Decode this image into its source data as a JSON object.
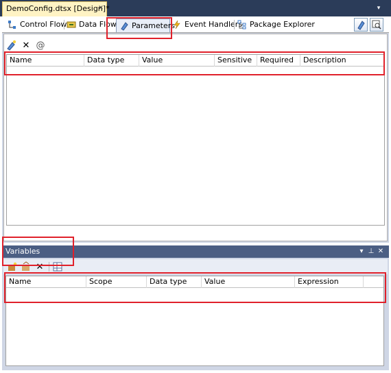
{
  "document_tab": {
    "title": "DemoConfig.dtsx [Design]*",
    "close_glyph": "✕",
    "dropdown_glyph": "▾"
  },
  "designer_tabs": [
    {
      "label": "Control Flow",
      "icon": "control-flow-icon"
    },
    {
      "label": "Data Flow",
      "icon": "data-flow-icon"
    },
    {
      "label": "Parameters",
      "icon": "parameters-icon"
    },
    {
      "label": "Event Handlers",
      "icon": "event-handlers-icon"
    },
    {
      "label": "Package Explorer",
      "icon": "package-explorer-icon"
    }
  ],
  "parameters_toolbar": {
    "add_icon": "add-parameter-icon",
    "delete_glyph": "✕",
    "add_to_config_glyph": "@"
  },
  "parameters_grid": {
    "columns": [
      "Name",
      "Data type",
      "Value",
      "Sensitive",
      "Required",
      "Description"
    ]
  },
  "variables_pane": {
    "title": "Variables",
    "header_glyphs": {
      "dropdown": "▾",
      "pin": "⊥",
      "close": "✕"
    },
    "delete_glyph": "✕",
    "columns": [
      "Name",
      "Scope",
      "Data type",
      "Value",
      "Expression"
    ]
  },
  "colors": {
    "doc_strip": "#2b3c59",
    "active_doc_tab": "#fff3c4",
    "designer_frame": "#cfd6e5",
    "pane_header": "#4b5e83",
    "highlight_red": "#e0202a"
  }
}
